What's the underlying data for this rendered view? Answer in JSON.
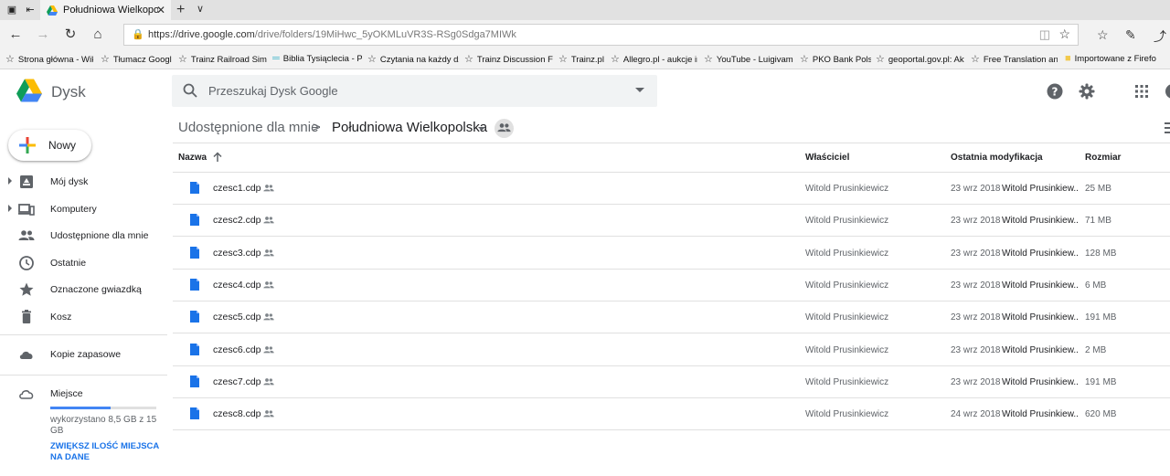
{
  "browser": {
    "tab_title": "Południowa Wielkopols",
    "url_host": "https://drive.google.com",
    "url_path": "/drive/folders/19MiHwc_5yOKMLuVR3S-RSg0Sdga7MIWk",
    "bookmarks": [
      "Strona główna - Wiki",
      "Tłumacz Google",
      "Trainz Railroad Simul",
      "Biblia Tysiąclecia - Pis",
      "Czytania na każdy dzi",
      "Trainz Discussion For",
      "Trainz.pl",
      "Allegro.pl - aukcje int",
      "YouTube - Luigivamp",
      "PKO Bank Polski",
      "geoportal.gov.pl: Akt",
      "Free Translation and I",
      "Importowane z Firefo"
    ]
  },
  "header": {
    "brand": "Dysk",
    "search_placeholder": "Przeszukaj Dysk Google"
  },
  "sidebar": {
    "new_label": "Nowy",
    "items": [
      {
        "label": "Mój dysk",
        "icon": "my-drive-icon"
      },
      {
        "label": "Komputery",
        "icon": "computers-icon"
      },
      {
        "label": "Udostępnione dla mnie",
        "icon": "shared-icon"
      },
      {
        "label": "Ostatnie",
        "icon": "clock-icon"
      },
      {
        "label": "Oznaczone gwiazdką",
        "icon": "star-icon"
      },
      {
        "label": "Kosz",
        "icon": "trash-icon"
      },
      {
        "label": "Kopie zapasowe",
        "icon": "cloud-icon"
      }
    ],
    "storage_label": "Miejsce",
    "storage_used_fraction": 0.567,
    "storage_text": "wykorzystano 8,5 GB z 15 GB",
    "upgrade_label": "ZWIĘKSZ ILOŚĆ MIEJSCA NA DANE"
  },
  "breadcrumb": {
    "parent": "Udostępnione dla mnie",
    "separator": ">",
    "current": "Południowa Wielkopolska"
  },
  "table": {
    "columns": {
      "name": "Nazwa",
      "owner": "Właściciel",
      "modified": "Ostatnia modyfikacja",
      "size": "Rozmiar"
    },
    "rows": [
      {
        "name": "czesc1.cdp",
        "owner": "Witold Prusinkiewicz",
        "date": "23 wrz 2018",
        "by": "Witold Prusinkiew...",
        "size": "25 MB"
      },
      {
        "name": "czesc2.cdp",
        "owner": "Witold Prusinkiewicz",
        "date": "23 wrz 2018",
        "by": "Witold Prusinkiew...",
        "size": "71 MB"
      },
      {
        "name": "czesc3.cdp",
        "owner": "Witold Prusinkiewicz",
        "date": "23 wrz 2018",
        "by": "Witold Prusinkiew...",
        "size": "128 MB"
      },
      {
        "name": "czesc4.cdp",
        "owner": "Witold Prusinkiewicz",
        "date": "23 wrz 2018",
        "by": "Witold Prusinkiew...",
        "size": "6 MB"
      },
      {
        "name": "czesc5.cdp",
        "owner": "Witold Prusinkiewicz",
        "date": "23 wrz 2018",
        "by": "Witold Prusinkiew...",
        "size": "191 MB"
      },
      {
        "name": "czesc6.cdp",
        "owner": "Witold Prusinkiewicz",
        "date": "23 wrz 2018",
        "by": "Witold Prusinkiew...",
        "size": "2 MB"
      },
      {
        "name": "czesc7.cdp",
        "owner": "Witold Prusinkiewicz",
        "date": "23 wrz 2018",
        "by": "Witold Prusinkiew...",
        "size": "191 MB"
      },
      {
        "name": "czesc8.cdp",
        "owner": "Witold Prusinkiewicz",
        "date": "24 wrz 2018",
        "by": "Witold Prusinkiew...",
        "size": "620 MB"
      }
    ]
  },
  "colors": {
    "accent": "#1a73e8",
    "doc_icon": "#1a73e8",
    "storage_bar": "#4285f4"
  }
}
